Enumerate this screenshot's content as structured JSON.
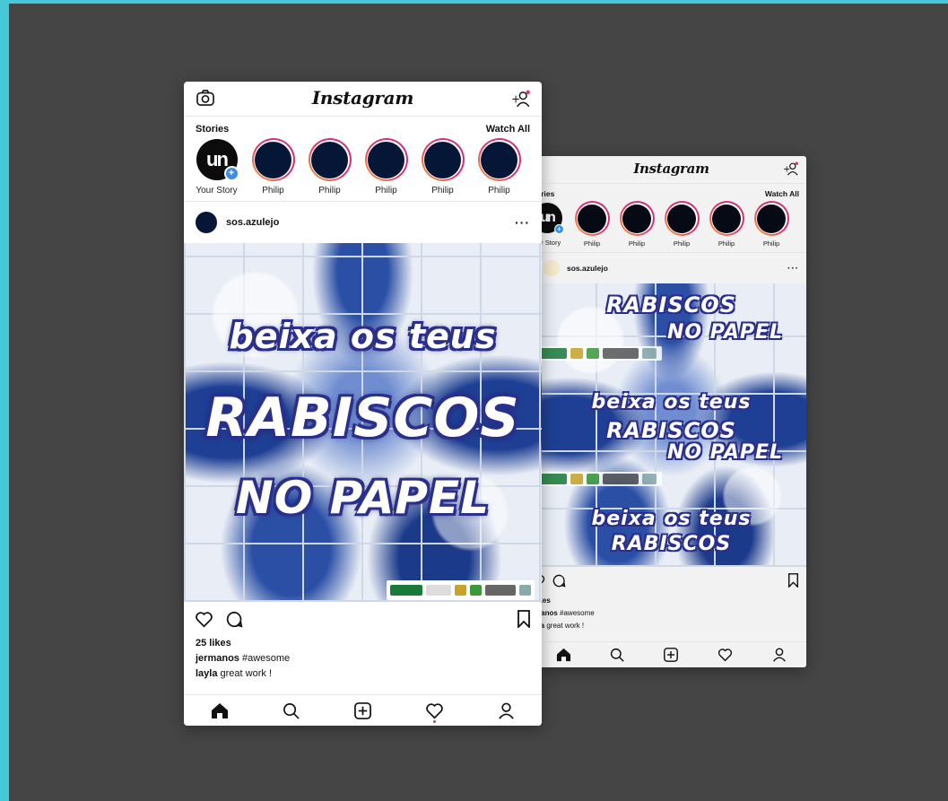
{
  "app": {
    "title": "Instagram"
  },
  "stories": {
    "heading": "Stories",
    "watch_all": "Watch All",
    "own_label": "Your Story",
    "own_avatar_text": "un",
    "items": [
      {
        "name": "Philip"
      },
      {
        "name": "Philip"
      },
      {
        "name": "Philip"
      },
      {
        "name": "Philip"
      },
      {
        "name": "Philip"
      }
    ]
  },
  "post": {
    "username": "sos.azulejo",
    "more": "···",
    "artwork_lines": [
      "beixa os teus",
      "RABISCOS",
      "NO PAPEL"
    ],
    "likes": "25 likes",
    "caption_user": "jermanos",
    "caption_text": "#awesome",
    "comment_user": "layla",
    "comment_text": "great work !"
  },
  "back_phone": {
    "title": "Instagram",
    "stories_heading": "ories",
    "watch_all": "Watch All",
    "own_label": "our Story",
    "own_avatar_text": "un",
    "items": [
      {
        "name": "Philip"
      },
      {
        "name": "Philip"
      },
      {
        "name": "Philip"
      },
      {
        "name": "Philip"
      },
      {
        "name": "Philip"
      }
    ],
    "username": "sos.azulejo",
    "more": "···",
    "artwork_lines": [
      "beixa os teus",
      "RABISCOS",
      "NO PAPEL",
      "beixa os teus",
      "RABISCOS",
      "NO PAPEL",
      "beixa os teus",
      "RABISCOS"
    ],
    "likes": "likes",
    "caption_user": "manos",
    "caption_text": "#awesome",
    "comment_user": "yla",
    "comment_text": "great work !"
  },
  "colors": {
    "background": "#454545",
    "frame": "#45c9d6",
    "story_ring_start": "#f9a63a",
    "story_ring_end": "#c13584",
    "notification_dot": "#e1306c",
    "add_story": "#3c8ce8",
    "story_fill": "#051637"
  },
  "icons": {
    "top_left": "camera-icon",
    "top_right": "add-user-icon",
    "like": "heart-icon",
    "comment": "comment-icon",
    "save": "bookmark-icon",
    "nav": [
      "home-icon",
      "search-icon",
      "add-post-icon",
      "activity-heart-icon",
      "profile-icon"
    ]
  }
}
